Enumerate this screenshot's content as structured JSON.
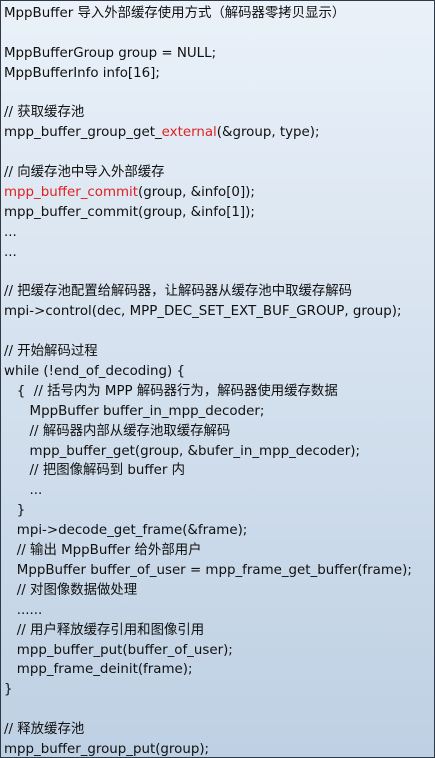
{
  "document": {
    "lines": [
      {
        "segments": [
          {
            "text": "MppBuffer 导入外部缓存使用方式（解码器零拷贝显示）"
          }
        ]
      },
      {
        "segments": [
          {
            "text": ""
          }
        ]
      },
      {
        "segments": [
          {
            "text": "MppBufferGroup group = NULL;"
          }
        ]
      },
      {
        "segments": [
          {
            "text": "MppBufferInfo info[16];"
          }
        ]
      },
      {
        "segments": [
          {
            "text": ""
          }
        ]
      },
      {
        "segments": [
          {
            "text": "// 获取缓存池"
          }
        ]
      },
      {
        "segments": [
          {
            "text": "mpp_buffer_group_get_"
          },
          {
            "text": "external",
            "highlight": true
          },
          {
            "text": "(&group, type);"
          }
        ]
      },
      {
        "segments": [
          {
            "text": ""
          }
        ]
      },
      {
        "segments": [
          {
            "text": "// 向缓存池中导入外部缓存"
          }
        ]
      },
      {
        "segments": [
          {
            "text": "mpp_buffer_commit",
            "highlight": true
          },
          {
            "text": "(group, &info[0]);"
          }
        ]
      },
      {
        "segments": [
          {
            "text": "mpp_buffer_commit(group, &info[1]);"
          }
        ]
      },
      {
        "segments": [
          {
            "text": "..."
          }
        ]
      },
      {
        "segments": [
          {
            "text": "..."
          }
        ]
      },
      {
        "segments": [
          {
            "text": ""
          }
        ]
      },
      {
        "segments": [
          {
            "text": "// 把缓存池配置给解码器，让解码器从缓存池中取缓存解码"
          }
        ]
      },
      {
        "segments": [
          {
            "text": "mpi->control(dec, MPP_DEC_SET_EXT_BUF_GROUP, group);"
          }
        ]
      },
      {
        "segments": [
          {
            "text": ""
          }
        ]
      },
      {
        "segments": [
          {
            "text": "// 开始解码过程"
          }
        ]
      },
      {
        "segments": [
          {
            "text": "while (!end_of_decoding) {"
          }
        ]
      },
      {
        "segments": [
          {
            "text": "   {  // 括号内为 MPP 解码器行为，解码器使用缓存数据"
          }
        ]
      },
      {
        "segments": [
          {
            "text": "      MppBuffer buffer_in_mpp_decoder;"
          }
        ]
      },
      {
        "segments": [
          {
            "text": "      // 解码器内部从缓存池取缓存解码"
          }
        ]
      },
      {
        "segments": [
          {
            "text": "      mpp_buffer_get(group, &bufer_in_mpp_decoder);"
          }
        ]
      },
      {
        "segments": [
          {
            "text": "      // 把图像解码到 buffer 内"
          }
        ]
      },
      {
        "segments": [
          {
            "text": "      ..."
          }
        ]
      },
      {
        "segments": [
          {
            "text": "   }"
          }
        ]
      },
      {
        "segments": [
          {
            "text": "   mpi->decode_get_frame(&frame);"
          }
        ]
      },
      {
        "segments": [
          {
            "text": "   // 输出 MppBuffer 给外部用户"
          }
        ]
      },
      {
        "segments": [
          {
            "text": "   MppBuffer buffer_of_user = mpp_frame_get_buffer(frame);"
          }
        ]
      },
      {
        "segments": [
          {
            "text": "   // 对图像数据做处理"
          }
        ]
      },
      {
        "segments": [
          {
            "text": "   ......"
          }
        ]
      },
      {
        "segments": [
          {
            "text": "   // 用户释放缓存引用和图像引用"
          }
        ]
      },
      {
        "segments": [
          {
            "text": "   mpp_buffer_put(buffer_of_user);"
          }
        ]
      },
      {
        "segments": [
          {
            "text": "   mpp_frame_deinit(frame);"
          }
        ]
      },
      {
        "segments": [
          {
            "text": "}"
          }
        ]
      },
      {
        "segments": [
          {
            "text": ""
          }
        ]
      },
      {
        "segments": [
          {
            "text": "// 释放缓存池"
          }
        ]
      },
      {
        "segments": [
          {
            "text": "mpp_buffer_group_put(group);"
          }
        ]
      }
    ]
  },
  "colors": {
    "text": "#101010",
    "highlight": "#e02020",
    "border": "#2f3a46",
    "background_top": "#eaf1f9",
    "background_bottom": "#bed0e3"
  }
}
